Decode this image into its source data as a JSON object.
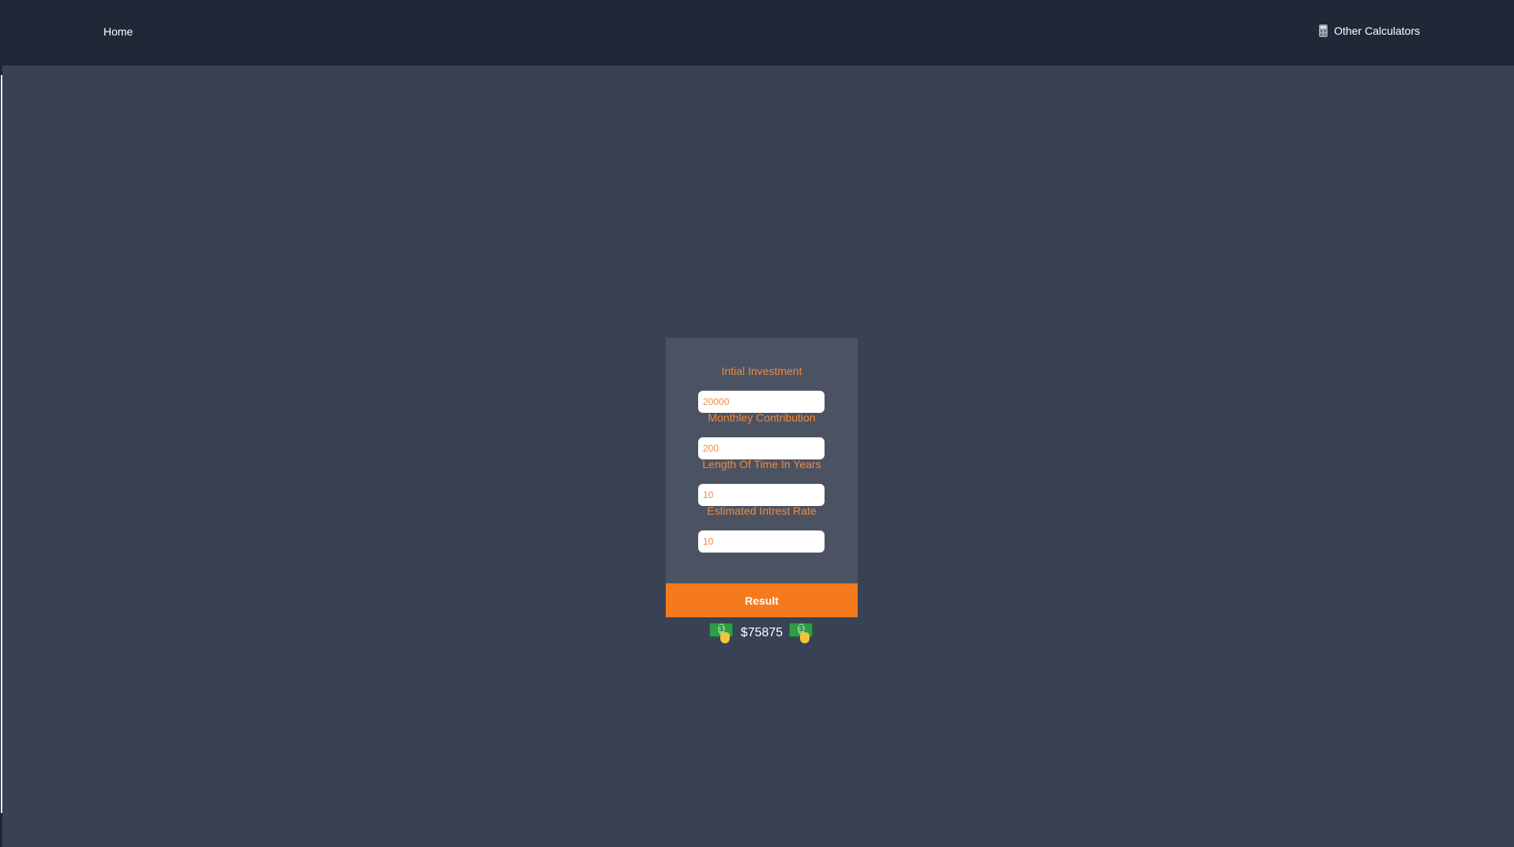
{
  "nav": {
    "home_label": "Home",
    "other_label": "Other Calculators",
    "other_icon": "calculator-icon"
  },
  "form": {
    "initial_investment": {
      "label": "Intial Investment",
      "value": "20000"
    },
    "monthly_contribution": {
      "label": "Monthley Contribution",
      "value": "200"
    },
    "length_years": {
      "label": "Length Of Time In Years",
      "value": "10"
    },
    "interest_rate": {
      "label": "Estimated Intrest Rate",
      "value": "10"
    }
  },
  "result": {
    "button_label": "Result",
    "value": "$75875",
    "icon": "money-with-hand-icon"
  },
  "colors": {
    "page_bg": "#394254",
    "navbar_bg": "#1f2837",
    "card_bg": "#4b5363",
    "accent": "#f47a1d",
    "label": "#f3883b"
  }
}
